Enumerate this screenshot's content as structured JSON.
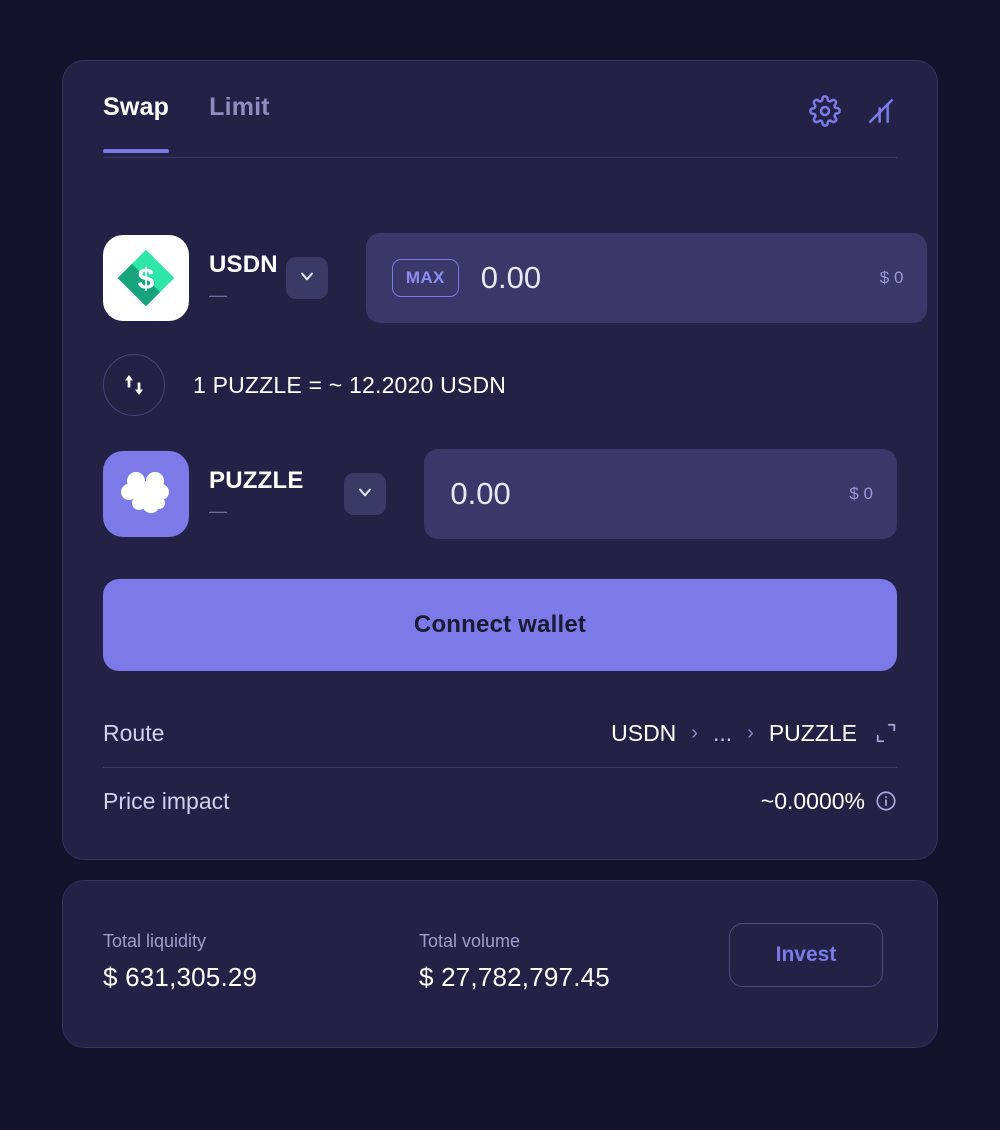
{
  "theme": {
    "page_bg": "#14132b",
    "card_bg": "#232246",
    "accent": "#7b7ae8",
    "field_bg": "#393869",
    "muted_text": "#9e9dcd"
  },
  "swap_panel": {
    "tabs": [
      {
        "label": "Swap",
        "active": true
      },
      {
        "label": "Limit",
        "active": false
      }
    ],
    "header_icons": [
      {
        "name": "gear-icon"
      },
      {
        "name": "chart-icon"
      }
    ],
    "from": {
      "token_symbol": "USDN",
      "token_subtitle": "—",
      "logo_name": "usdn-token-logo",
      "max_label": "MAX",
      "amount": "0.00",
      "amount_placeholder": "0.00",
      "usd_value": "$ 0"
    },
    "rate": {
      "text": "1 PUZZLE = ~ 12.2020 USDN",
      "toggle_icon": "swap-direction-icon"
    },
    "to": {
      "token_symbol": "PUZZLE",
      "token_subtitle": "—",
      "logo_name": "puzzle-token-logo",
      "amount": "0.00",
      "amount_placeholder": "0.00",
      "usd_value": "$ 0"
    },
    "connect_label": "Connect wallet",
    "route": {
      "label": "Route",
      "from": "USDN",
      "middle": "...",
      "to": "PUZZLE",
      "separator": "›"
    },
    "price_impact": {
      "label": "Price impact",
      "value": "~0.0000%"
    }
  },
  "stats_panel": {
    "liquidity": {
      "label": "Total liquidity",
      "value": "$ 631,305.29"
    },
    "volume": {
      "label": "Total volume",
      "value": "$ 27,782,797.45"
    },
    "invest_label": "Invest"
  }
}
